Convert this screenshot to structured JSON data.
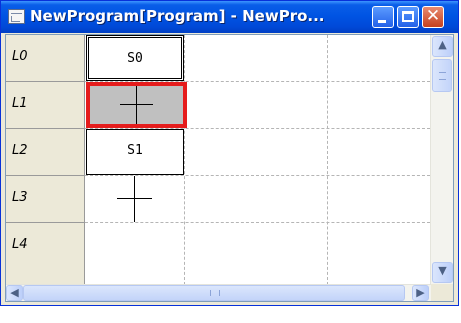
{
  "window": {
    "title": "NewProgram[Program] - NewPro...",
    "controls": {
      "minimize_icon": "minimize-icon",
      "maximize_icon": "maximize-icon",
      "close_glyph": "✕"
    }
  },
  "ladder": {
    "rows": [
      {
        "label": "L0",
        "cell_text": "S0",
        "element": "step-box-initial"
      },
      {
        "label": "L1",
        "cell_text": "",
        "element": "transition-selected"
      },
      {
        "label": "L2",
        "cell_text": "S1",
        "element": "step-box"
      },
      {
        "label": "L3",
        "cell_text": "",
        "element": "transition"
      },
      {
        "label": "L4",
        "cell_text": "",
        "element": "empty"
      }
    ],
    "selected_row": 1
  },
  "scrollbars": {
    "up_glyph": "▲",
    "down_glyph": "▼",
    "left_glyph": "◀",
    "right_glyph": "▶"
  },
  "colors": {
    "selection_border": "#e51c1c",
    "selection_fill": "#c0c0c0",
    "titlebar": "#0054e3"
  }
}
